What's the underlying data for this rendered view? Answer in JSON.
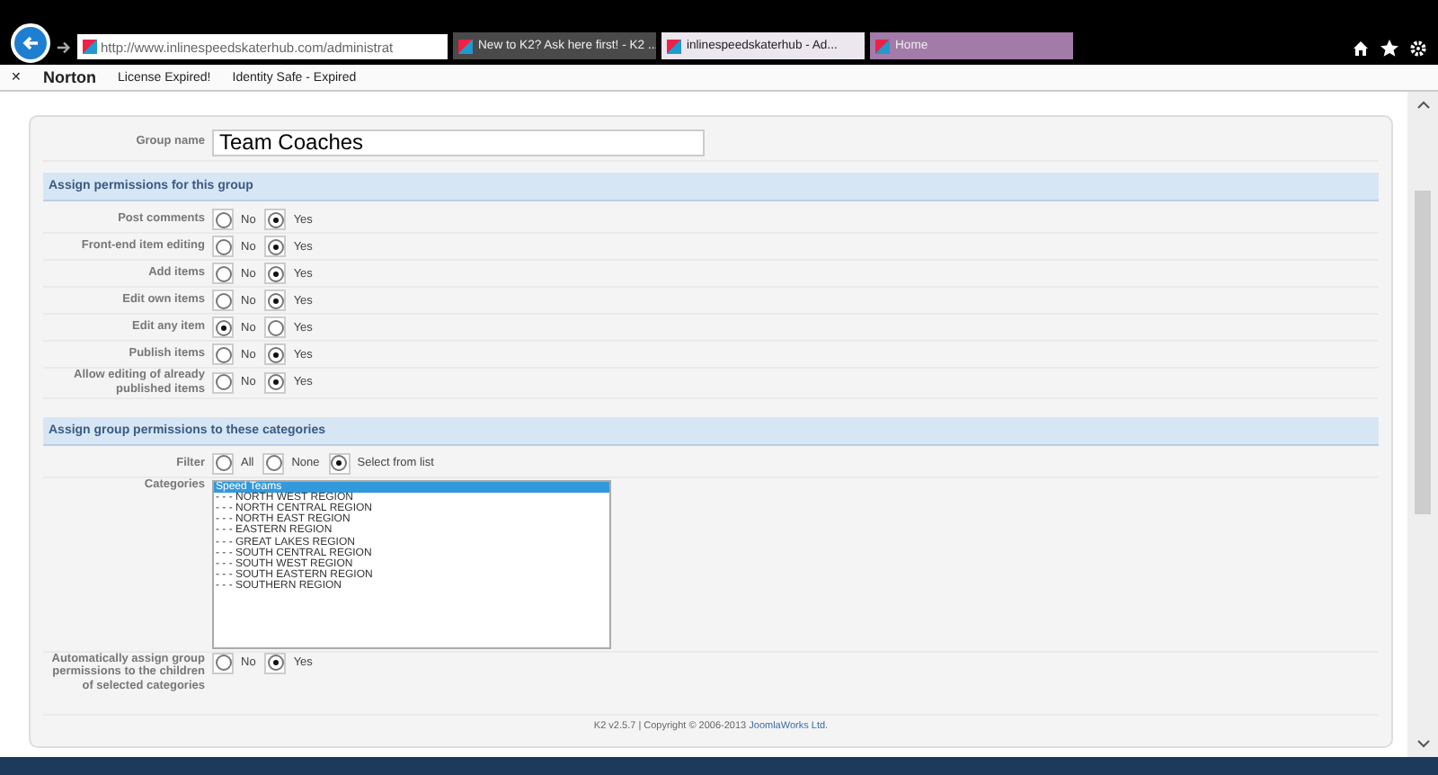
{
  "browser": {
    "url": "http://www.inlinespeedskaterhub.com/administrat",
    "tabs": [
      {
        "label": "New to K2? Ask here first! - K2 ...",
        "selected": false,
        "color": "#4a4a4a"
      },
      {
        "label": "inlinespeedskaterhub - Ad...",
        "selected": true,
        "color": "#ece6ef"
      },
      {
        "label": "Home",
        "selected": false,
        "color": "#a27ba8"
      }
    ]
  },
  "toolbar": {
    "close": "✕",
    "brand": "Norton",
    "items": [
      "License Expired!",
      "Identity Safe - Expired"
    ]
  },
  "group_name": {
    "label": "Group name",
    "value": "Team Coaches"
  },
  "permissions": {
    "title": "Assign permissions for this group",
    "rows": [
      {
        "label": "Post comments",
        "options": [
          {
            "label": "No",
            "selected": false
          },
          {
            "label": "Yes",
            "selected": true
          }
        ]
      },
      {
        "label": "Front-end item editing",
        "options": [
          {
            "label": "No",
            "selected": false
          },
          {
            "label": "Yes",
            "selected": true
          }
        ]
      },
      {
        "label": "Add items",
        "options": [
          {
            "label": "No",
            "selected": false
          },
          {
            "label": "Yes",
            "selected": true
          }
        ]
      },
      {
        "label": "Edit own items",
        "options": [
          {
            "label": "No",
            "selected": false
          },
          {
            "label": "Yes",
            "selected": true
          }
        ]
      },
      {
        "label": "Edit any item",
        "options": [
          {
            "label": "No",
            "selected": true
          },
          {
            "label": "Yes",
            "selected": false
          }
        ]
      },
      {
        "label": "Publish items",
        "options": [
          {
            "label": "No",
            "selected": false
          },
          {
            "label": "Yes",
            "selected": true
          }
        ]
      },
      {
        "label": "Allow editing of already published items",
        "options": [
          {
            "label": "No",
            "selected": false
          },
          {
            "label": "Yes",
            "selected": true
          }
        ]
      }
    ]
  },
  "categories_section": {
    "title": "Assign group permissions to these categories",
    "filter": {
      "label": "Filter",
      "options": [
        {
          "label": "All",
          "selected": false
        },
        {
          "label": "None",
          "selected": false
        },
        {
          "label": "Select from list",
          "selected": true
        }
      ]
    },
    "categories": {
      "label": "Categories",
      "items": [
        {
          "label": "Speed Teams",
          "selected": true
        },
        {
          "label": "- - - NORTH WEST REGION",
          "selected": false
        },
        {
          "label": "- - - NORTH CENTRAL REGION",
          "selected": false
        },
        {
          "label": "- - - NORTH EAST REGION",
          "selected": false
        },
        {
          "label": "- - - EASTERN REGION",
          "selected": false
        },
        {
          "label": "- - - GREAT LAKES REGION",
          "selected": false
        },
        {
          "label": "- - - SOUTH CENTRAL REGION",
          "selected": false
        },
        {
          "label": "- - - SOUTH WEST REGION",
          "selected": false
        },
        {
          "label": "- - - SOUTH EASTERN REGION",
          "selected": false
        },
        {
          "label": "- - - SOUTHERN REGION",
          "selected": false
        }
      ]
    },
    "auto_assign": {
      "label": "Automatically assign group permissions to the children of selected categories",
      "options": [
        {
          "label": "No",
          "selected": false
        },
        {
          "label": "Yes",
          "selected": true
        }
      ]
    }
  },
  "footer": {
    "text": "K2 v2.5.7 | Copyright © 2006-2013",
    "link": "JoomlaWorks Ltd."
  }
}
